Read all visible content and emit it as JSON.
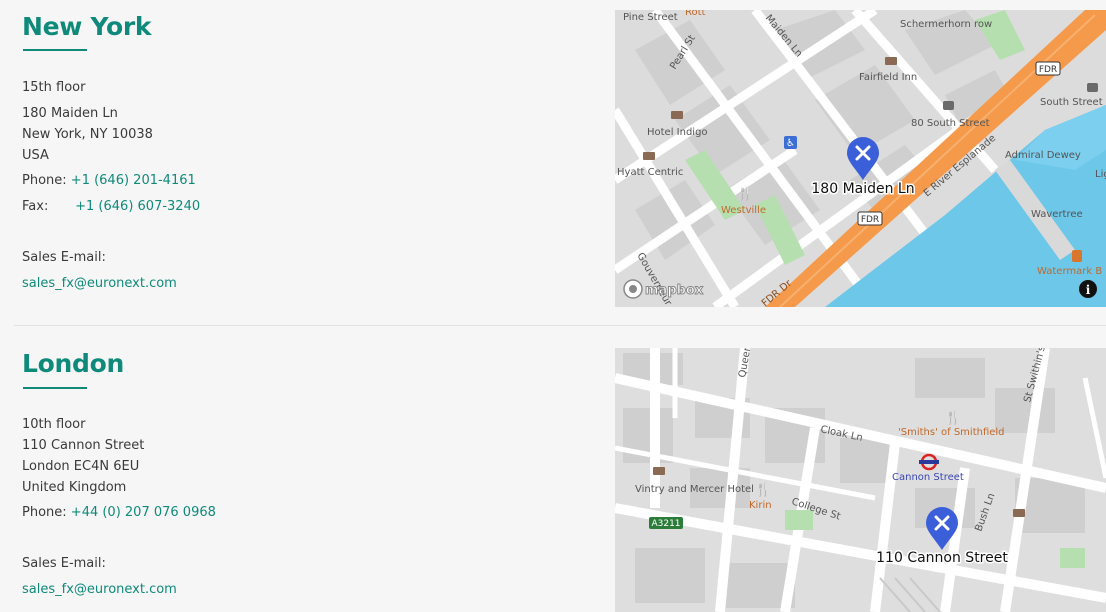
{
  "offices": [
    {
      "city": "New York",
      "floor": "15th floor",
      "street": "180 Maiden Ln",
      "city_line": "New York, NY 10038",
      "country": "USA",
      "phone_label": "Phone:",
      "phone": "+1 (646) 201-4161",
      "fax_label": "Fax:",
      "fax": "+1 (646) 607-3240",
      "sales_label": "Sales E-mail:",
      "email": "sales_fx@euronext.com",
      "map": {
        "pin_label": "180 Maiden Ln",
        "places": [
          "Pine Street",
          "Schermerhorn row",
          "Pearl St",
          "Maiden Ln",
          "Fairfield Inn",
          "South Street",
          "Hotel Indigo",
          "80 South Street",
          "Admiral Dewey",
          "Hyatt Centric",
          "Westville",
          "E River Esplanade",
          "Wavertree",
          "Gouverneur",
          "Watermark B",
          "FDR Dr",
          "Ligh",
          "Rott"
        ],
        "shield": "FDR",
        "attribution": "mapbox"
      }
    },
    {
      "city": "London",
      "floor": "10th floor",
      "street": "110 Cannon Street",
      "city_line": "London EC4N 6EU",
      "country": "United Kingdom",
      "phone_label": "Phone:",
      "phone": "+44 (0) 207 076 0968",
      "sales_label": "Sales E-mail:",
      "email": "sales_fx@euronext.com",
      "map": {
        "pin_label": "110 Cannon Street",
        "places": [
          "Queen",
          "St Swithin's",
          "Cloak Ln",
          "'Smiths' of Smithfield",
          "Cannon Street",
          "Vintry and Mercer Hotel",
          "Kirin",
          "College St",
          "Bush Ln"
        ],
        "shield": "A3211"
      }
    }
  ],
  "colors": {
    "accent": "#0f8a7a",
    "background": "#f6f6f6",
    "pin": "#3b5fd9",
    "water": "#6cc7e9",
    "highway": "#f59a4b"
  }
}
